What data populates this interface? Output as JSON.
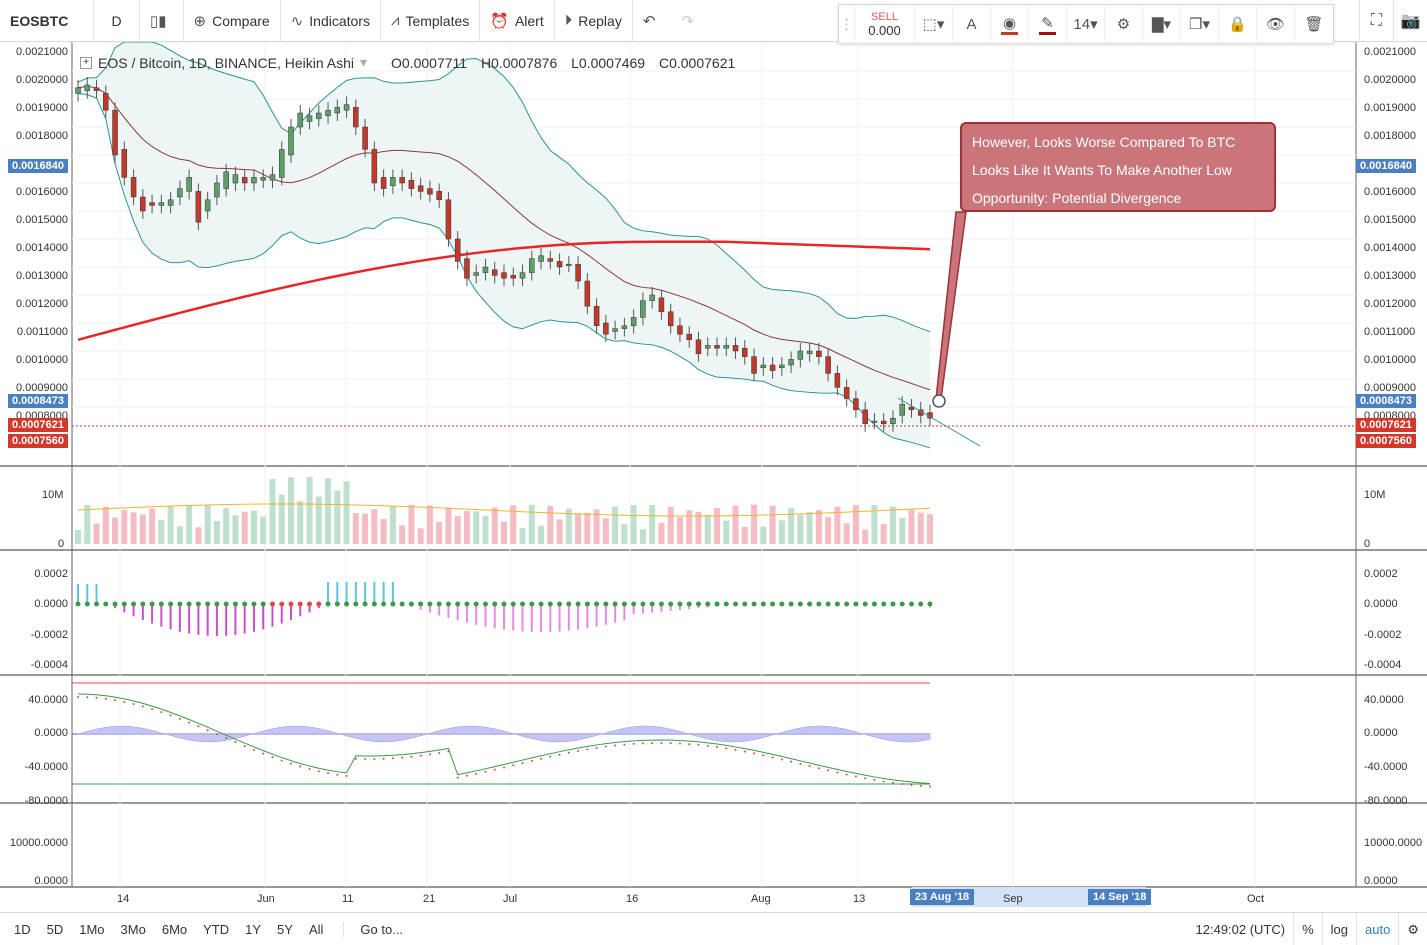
{
  "toolbar": {
    "symbol": "EOSBTC",
    "interval": "D",
    "compare": "Compare",
    "indicators": "Indicators",
    "templates": "Templates",
    "alert": "Alert",
    "replay": "Replay"
  },
  "drawtools": {
    "sell_label": "SELL",
    "sell_value": "0.000",
    "font_size": "14"
  },
  "legend": {
    "title": "EOS / Bitcoin, 1D, BINANCE, Heikin Ashi",
    "open": "O0.0007711",
    "high": "H0.0007876",
    "low": "L0.0007469",
    "close": "C0.0007621"
  },
  "price_axis": [
    "0.0021000",
    "0.0020000",
    "0.0019000",
    "0.0018000",
    "0.0017000",
    "0.0016000",
    "0.0015000",
    "0.0014000",
    "0.0013000",
    "0.0012000",
    "0.0011000",
    "0.0010000",
    "0.0009000",
    "0.0008000"
  ],
  "price_tags": {
    "upper_band": "0.0016840",
    "lower_band": "0.0008473",
    "last": "0.0007621",
    "mid": "0.0007560"
  },
  "volume_axis": [
    "10M",
    "0"
  ],
  "osc_axis": [
    "0.0002",
    "0.0000",
    "-0.0002",
    "-0.0004"
  ],
  "rsi_axis": [
    "40.0000",
    "0.0000",
    "-40.0000",
    "-80.0000"
  ],
  "low_axis": [
    "10000.0000",
    "0.0000"
  ],
  "callout": {
    "line1": "However, Looks Worse Compared To BTC",
    "line2": "Looks Like It Wants To Make Another Low",
    "line3": "Opportunity: Potential Divergence"
  },
  "x_axis": {
    "labels": [
      "14",
      "Jun",
      "11",
      "21",
      "Jul",
      "16",
      "Aug",
      "13",
      "Sep",
      "Oct"
    ],
    "tag_start": "23 Aug '18",
    "tag_end": "14 Sep '18"
  },
  "bottombar": {
    "ranges": [
      "1D",
      "5D",
      "1Mo",
      "3Mo",
      "6Mo",
      "YTD",
      "1Y",
      "5Y",
      "All"
    ],
    "goto": "Go to...",
    "time": "12:49:02 (UTC)",
    "percent": "%",
    "log": "log",
    "auto": "auto"
  },
  "colors": {
    "bull": "#5d9e6b",
    "bear": "#c0392b",
    "ma200": "#e8262a",
    "ma20": "#8b3a3a",
    "bands": "#2a9595",
    "accent": "#4a7fc1"
  },
  "candles_ha": [
    {
      "o": 0.00192,
      "c": 0.00194
    },
    {
      "o": 0.00193,
      "c": 0.00195
    },
    {
      "o": 0.00194,
      "c": 0.00193
    },
    {
      "o": 0.00192,
      "c": 0.00186
    },
    {
      "o": 0.00186,
      "c": 0.0017
    },
    {
      "o": 0.00172,
      "c": 0.00162
    },
    {
      "o": 0.00162,
      "c": 0.00155
    },
    {
      "o": 0.00155,
      "c": 0.0015
    },
    {
      "o": 0.00153,
      "c": 0.00152
    },
    {
      "o": 0.00152,
      "c": 0.00153
    },
    {
      "o": 0.00152,
      "c": 0.00154
    },
    {
      "o": 0.00155,
      "c": 0.00158
    },
    {
      "o": 0.00157,
      "c": 0.00162
    },
    {
      "o": 0.00157,
      "c": 0.00146
    },
    {
      "o": 0.0015,
      "c": 0.00154
    },
    {
      "o": 0.00155,
      "c": 0.0016
    },
    {
      "o": 0.00158,
      "c": 0.00164
    },
    {
      "o": 0.0016,
      "c": 0.00163
    },
    {
      "o": 0.00162,
      "c": 0.0016
    },
    {
      "o": 0.0016,
      "c": 0.00162
    },
    {
      "o": 0.00161,
      "c": 0.00162
    },
    {
      "o": 0.00161,
      "c": 0.00163
    },
    {
      "o": 0.00162,
      "c": 0.00172
    },
    {
      "o": 0.0017,
      "c": 0.0018
    },
    {
      "o": 0.0018,
      "c": 0.00185
    },
    {
      "o": 0.00182,
      "c": 0.00184
    },
    {
      "o": 0.00183,
      "c": 0.00185
    },
    {
      "o": 0.00184,
      "c": 0.00186
    },
    {
      "o": 0.00185,
      "c": 0.00187
    },
    {
      "o": 0.00186,
      "c": 0.00188
    },
    {
      "o": 0.00187,
      "c": 0.0018
    },
    {
      "o": 0.0018,
      "c": 0.00172
    },
    {
      "o": 0.00172,
      "c": 0.0016
    },
    {
      "o": 0.00162,
      "c": 0.00158
    },
    {
      "o": 0.00159,
      "c": 0.00162
    },
    {
      "o": 0.00162,
      "c": 0.0016
    },
    {
      "o": 0.00161,
      "c": 0.00158
    },
    {
      "o": 0.00159,
      "c": 0.00157
    },
    {
      "o": 0.00158,
      "c": 0.00156
    },
    {
      "o": 0.00157,
      "c": 0.00154
    },
    {
      "o": 0.00154,
      "c": 0.0014
    },
    {
      "o": 0.0014,
      "c": 0.00132
    },
    {
      "o": 0.00133,
      "c": 0.00126
    },
    {
      "o": 0.00127,
      "c": 0.00128
    },
    {
      "o": 0.00128,
      "c": 0.0013
    },
    {
      "o": 0.00129,
      "c": 0.00127
    },
    {
      "o": 0.00128,
      "c": 0.00126
    },
    {
      "o": 0.00127,
      "c": 0.00126
    },
    {
      "o": 0.00126,
      "c": 0.00128
    },
    {
      "o": 0.00128,
      "c": 0.00133
    },
    {
      "o": 0.00132,
      "c": 0.00134
    },
    {
      "o": 0.00133,
      "c": 0.00132
    },
    {
      "o": 0.00132,
      "c": 0.0013
    },
    {
      "o": 0.00131,
      "c": 0.00131
    },
    {
      "o": 0.00131,
      "c": 0.00125
    },
    {
      "o": 0.00125,
      "c": 0.00116
    },
    {
      "o": 0.00116,
      "c": 0.00109
    },
    {
      "o": 0.0011,
      "c": 0.00106
    },
    {
      "o": 0.00107,
      "c": 0.00108
    },
    {
      "o": 0.00108,
      "c": 0.00109
    },
    {
      "o": 0.00109,
      "c": 0.00112
    },
    {
      "o": 0.00112,
      "c": 0.00118
    },
    {
      "o": 0.00118,
      "c": 0.0012
    },
    {
      "o": 0.00119,
      "c": 0.00114
    },
    {
      "o": 0.00114,
      "c": 0.00109
    },
    {
      "o": 0.00109,
      "c": 0.00106
    },
    {
      "o": 0.00106,
      "c": 0.00104
    },
    {
      "o": 0.00104,
      "c": 0.00099
    },
    {
      "o": 0.00101,
      "c": 0.00102
    },
    {
      "o": 0.00102,
      "c": 0.00101
    },
    {
      "o": 0.00101,
      "c": 0.00102
    },
    {
      "o": 0.00102,
      "c": 0.001
    },
    {
      "o": 0.00101,
      "c": 0.00098
    },
    {
      "o": 0.00098,
      "c": 0.00092
    },
    {
      "o": 0.00094,
      "c": 0.00095
    },
    {
      "o": 0.00095,
      "c": 0.00093
    },
    {
      "o": 0.00094,
      "c": 0.00095
    },
    {
      "o": 0.00095,
      "c": 0.00097
    },
    {
      "o": 0.00097,
      "c": 0.001
    },
    {
      "o": 0.00099,
      "c": 0.001
    },
    {
      "o": 0.001,
      "c": 0.00098
    },
    {
      "o": 0.00098,
      "c": 0.00092
    },
    {
      "o": 0.00092,
      "c": 0.00087
    },
    {
      "o": 0.00087,
      "c": 0.00083
    },
    {
      "o": 0.00083,
      "c": 0.00079
    },
    {
      "o": 0.00079,
      "c": 0.00074
    },
    {
      "o": 0.00075,
      "c": 0.00075
    },
    {
      "o": 0.00075,
      "c": 0.00074
    },
    {
      "o": 0.00074,
      "c": 0.00076
    },
    {
      "o": 0.00077,
      "c": 0.00081
    },
    {
      "o": 0.0008,
      "c": 0.00079
    },
    {
      "o": 0.00079,
      "c": 0.00077
    },
    {
      "o": 0.00078,
      "c": 0.00076
    }
  ]
}
